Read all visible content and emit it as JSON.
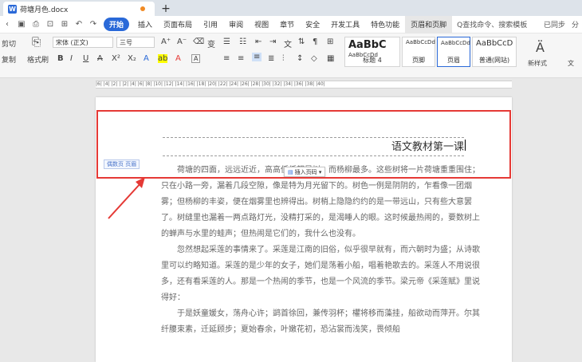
{
  "tab": {
    "doc_title": "荷塘月色.docx",
    "app_letter": "W"
  },
  "menu": {
    "start": "开始",
    "items": [
      "插入",
      "页面布局",
      "引用",
      "审阅",
      "视图",
      "章节",
      "安全",
      "开发工具",
      "特色功能"
    ],
    "active": "页眉和页脚",
    "search": "Q查找命令、搜索模板",
    "sync": "已同步",
    "share": "分"
  },
  "ribbon": {
    "cut": "剪切",
    "copy": "复制",
    "paste_fmt": "格式刷",
    "font_name": "宋体 (正文)",
    "font_size": "三号",
    "styles": [
      {
        "sample": "AaBbC",
        "sub": "AaBbCcDd",
        "caption": "标题 4"
      },
      {
        "sample": "AaBbCcDd",
        "caption": "页脚"
      },
      {
        "sample": "AaBbCcDd",
        "caption": "页眉"
      },
      {
        "sample": "AaBbCcD",
        "caption": "普通(网站)"
      }
    ],
    "new_style": "新样式",
    "text_tool": "文"
  },
  "ruler": {
    "ticks": "|6|  |4|  |2|  |  |2|  |4|  |6|  |8|  |10|  |12|  |14|  |16|  |18|  |20|  |22|  |24|  |26|  |28|  |30|  |32|  |34|  |36|  |38|  |40|"
  },
  "document": {
    "header_text": "语文教材第一课",
    "header_label": "偶数页 页眉",
    "insert_page_number": "插入页码",
    "paragraphs": [
      {
        "text": "荷塘的四面，远远近近，高高低低都是树，而杨柳最多。这些树将一片荷塘重重围住；只在小路一旁，漏着几段空隙，像是特为月光留下的。树色一例是阴阴的，乍看像一团烟雾；但杨柳的丰姿，便在烟雾里也辨得出。树梢上隐隐约约的是一带远山，只有些大意罢了。树缝里也漏着一两点路灯光，没精打采的，是渴睡人的眼。这时候最热闹的，要数树上的蝉声与水里的蛙声；但热闹是它们的，我什么也没有。",
        "indent": true
      },
      {
        "text": "忽然想起采莲的事情来了。采莲是江南的旧俗，似乎很早就有，而六朝时为盛；从诗歌里可以约略知道。采莲的是少年的女子，她们是荡着小船，唱着艳歌去的。采莲人不用说很多，还有看采莲的人。那是一个热闹的季节，也是一个风流的季节。梁元帝《采莲赋》里说得好：",
        "indent": true
      },
      {
        "text": "于是妖童媛女，荡舟心许；鹢首徐回，兼传羽杯；欋将移而藻挂，船欲动而萍开。尔其纤腰束素，迁延顾步；夏始春余，叶嫩花初，恐沾裳而浅笑，畏倾船",
        "indent": true
      }
    ]
  },
  "colors": {
    "accent": "#2a69d8",
    "annotation": "#e53935",
    "orange_dot": "#f08a24"
  }
}
